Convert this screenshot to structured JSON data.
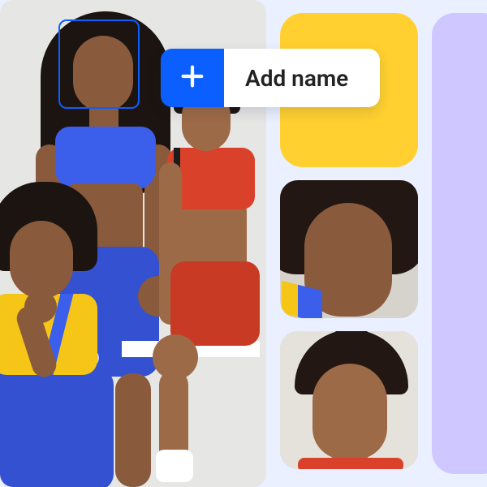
{
  "face_tag": {
    "add_label": "Add name",
    "plus_icon": "plus-icon"
  },
  "tiles": {
    "yellow": "decorative-tile-yellow",
    "lavender": "decorative-tile-lavender"
  },
  "thumbnails": [
    {
      "id": "face-crop-1"
    },
    {
      "id": "face-crop-2"
    }
  ]
}
